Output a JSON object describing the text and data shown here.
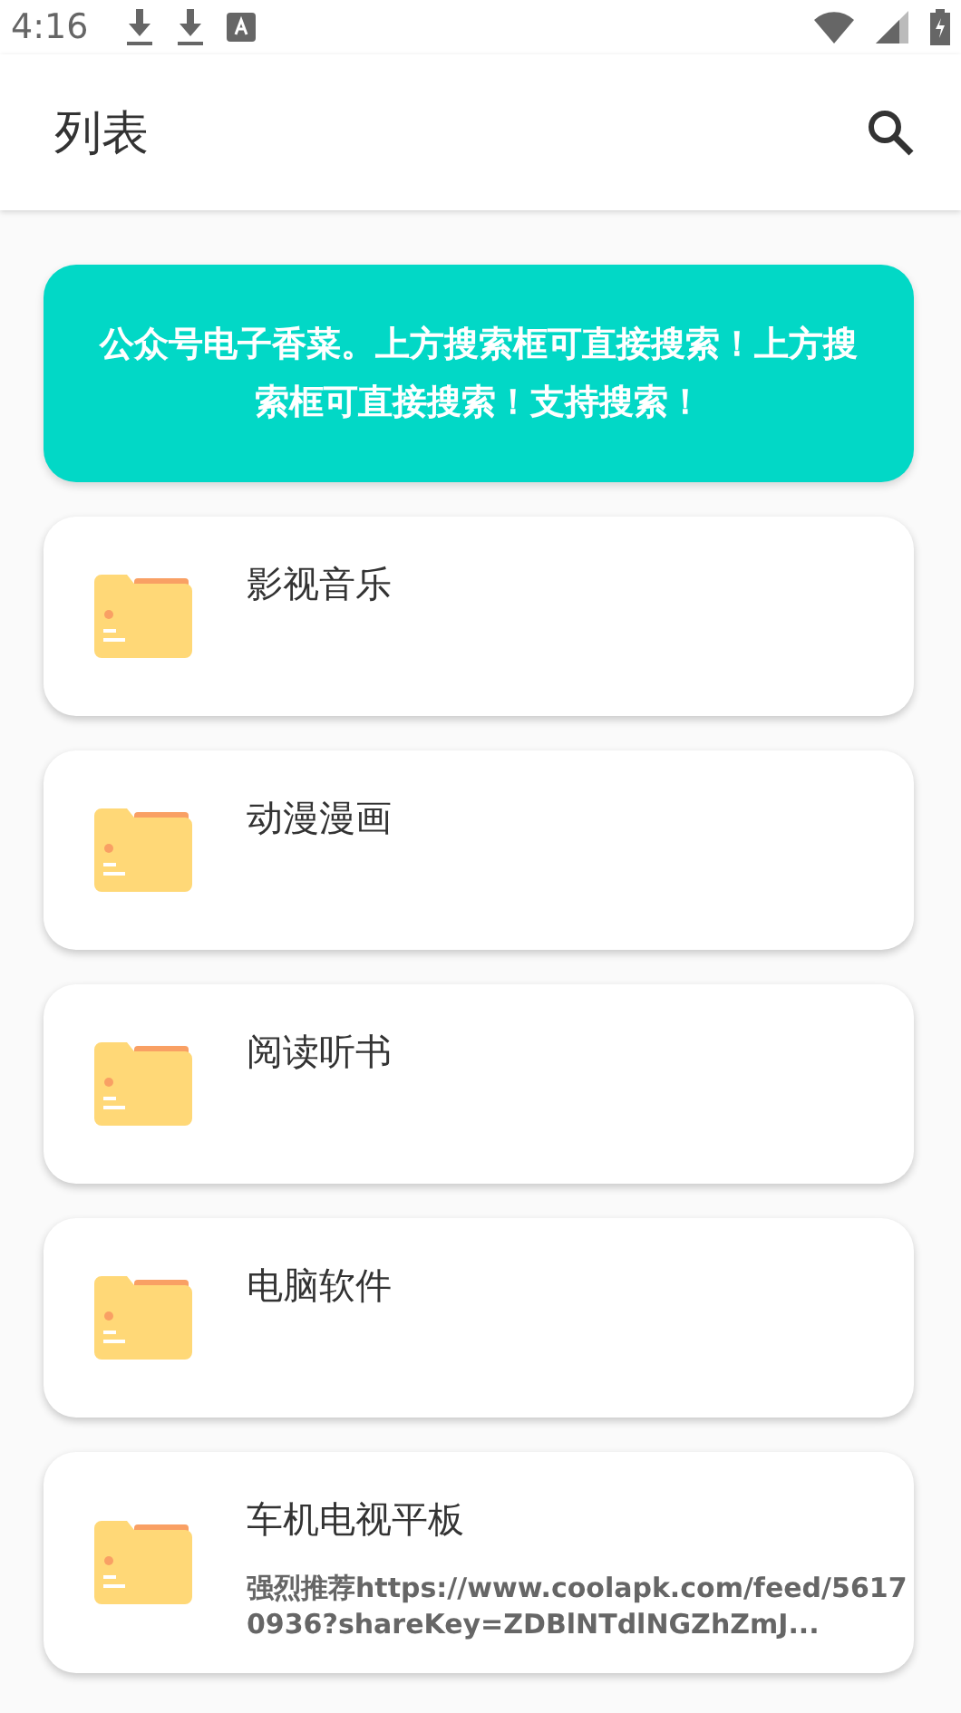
{
  "status_bar": {
    "time": "4:16"
  },
  "app_bar": {
    "title": "列表"
  },
  "banner": {
    "text": "公众号电子香菜。上方搜索框可直接搜索！上方搜索框可直接搜索！支持搜索！"
  },
  "items": [
    {
      "title": "影视音乐"
    },
    {
      "title": "动漫漫画"
    },
    {
      "title": "阅读听书"
    },
    {
      "title": "电脑软件"
    },
    {
      "title": "车机电视平板",
      "subtitle": "强烈推荐https://www.coolapk.com/feed/56170936?shareKey=ZDBlNTdlNGZhZmJ..."
    }
  ]
}
